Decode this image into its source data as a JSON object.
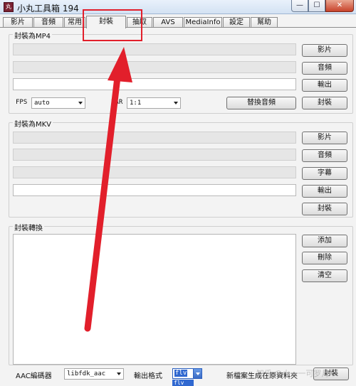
{
  "window": {
    "title": "小丸工具箱 194",
    "icon_glyph": "丸",
    "min_glyph": "—",
    "max_glyph": "☐",
    "close_glyph": "✕"
  },
  "tabs": [
    {
      "label": "影片"
    },
    {
      "label": "音頻"
    },
    {
      "label": "常用"
    },
    {
      "label": "封裝"
    },
    {
      "label": "抽取"
    },
    {
      "label": "AVS"
    },
    {
      "label": "MediaInfo"
    },
    {
      "label": "設定"
    },
    {
      "label": "幫助"
    }
  ],
  "active_tab": "封裝",
  "mp4": {
    "group_label": "封裝為MP4",
    "btn_video": "影片",
    "btn_audio": "音頻",
    "btn_output": "輸出",
    "fps_label": "FPS",
    "fps_value": "auto",
    "par_label": "PAR",
    "par_value": "1:1",
    "btn_replace_audio": "替換音頻",
    "btn_mux": "封裝"
  },
  "mkv": {
    "group_label": "封裝為MKV",
    "btn_video": "影片",
    "btn_audio": "音頻",
    "btn_subtitle": "字幕",
    "btn_output": "輸出",
    "btn_mux": "封裝"
  },
  "convert": {
    "group_label": "封裝轉換",
    "btn_add": "添加",
    "btn_delete": "刪除",
    "btn_clear": "清空",
    "aac_label": "AAC編碼器",
    "aac_value": "libfdk_aac",
    "format_label": "輸出格式",
    "format_value": "flv",
    "format_dropdown_item": "flv",
    "new_file_label": "新檔案生成在原資料夾",
    "btn_mux": "封裝"
  },
  "watermark": "知乎 @小一一可罗月",
  "colors": {
    "annotation": "#e21f2b"
  }
}
